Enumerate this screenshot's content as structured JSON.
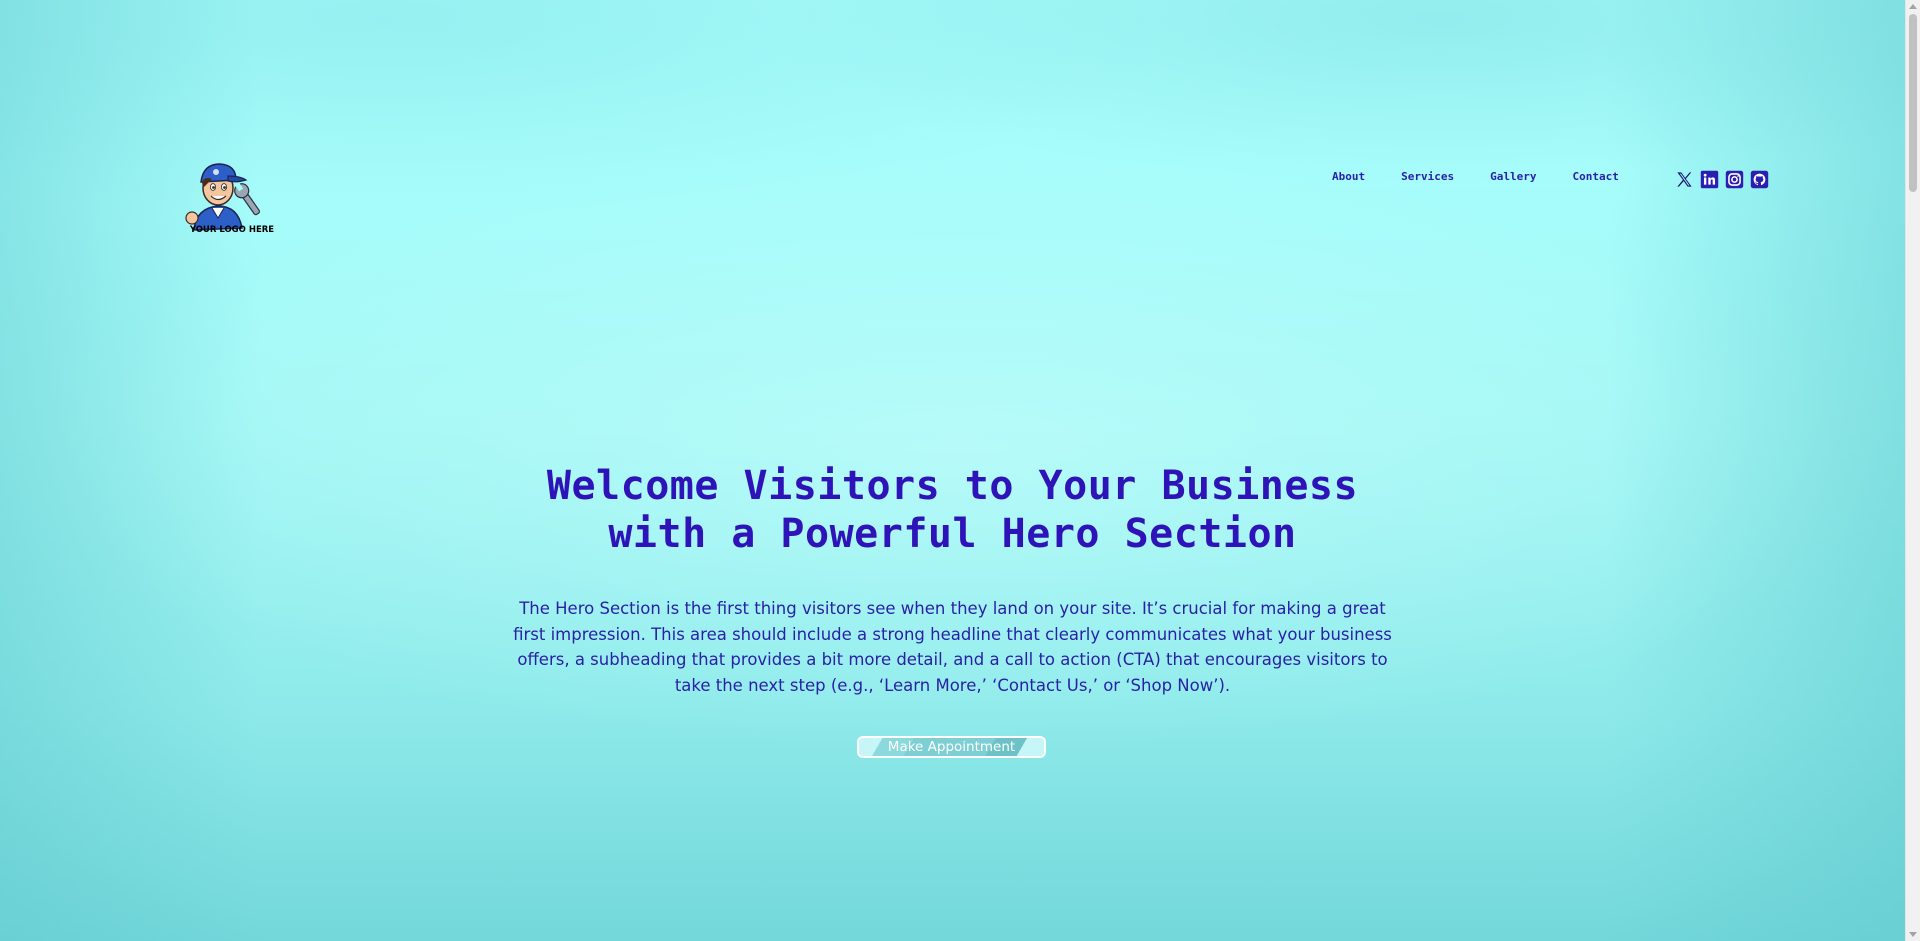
{
  "header": {
    "logo": {
      "icon": "mechanic-mascot-logo",
      "text": "YOUR LOGO HERE"
    },
    "nav": [
      {
        "label": "About"
      },
      {
        "label": "Services"
      },
      {
        "label": "Gallery"
      },
      {
        "label": "Contact"
      }
    ],
    "socials": [
      {
        "icon": "x-twitter-icon"
      },
      {
        "icon": "linkedin-icon"
      },
      {
        "icon": "instagram-icon"
      },
      {
        "icon": "github-icon"
      }
    ]
  },
  "hero": {
    "title_line1": "Welcome Visitors to Your Business",
    "title_line2": "with a Powerful Hero Section",
    "subtitle": "The Hero Section is the first thing visitors see when they land on your site. It’s crucial for making a great first impression. This area should include a strong headline that clearly communicates what your business offers, a subheading that provides a bit more detail, and a call to action (CTA) that encourages visitors to take the next step (e.g., ‘Learn More,’ ‘Contact Us,’ or ‘Shop Now’).",
    "cta_label": "Make Appointment"
  },
  "colors": {
    "accent": "#2e13b8",
    "background": "#a6fbf9"
  }
}
